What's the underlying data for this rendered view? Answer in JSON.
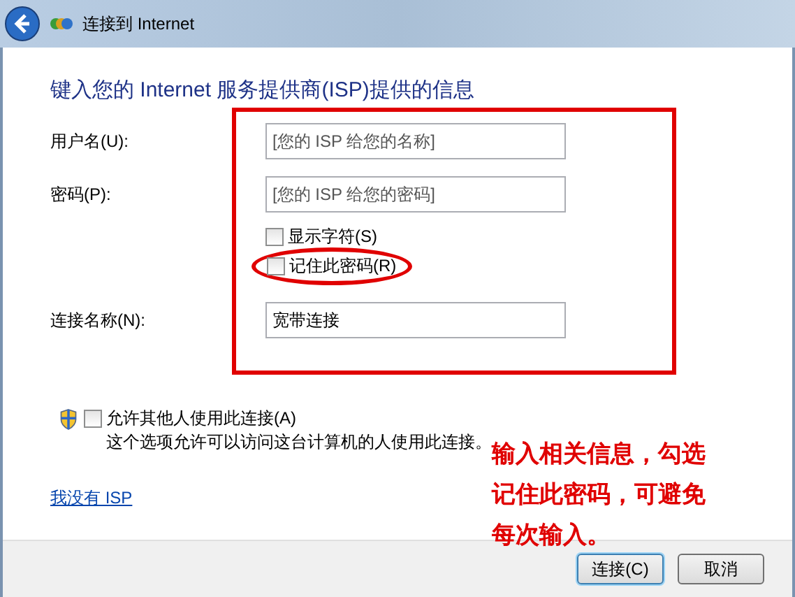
{
  "window": {
    "title": "连接到 Internet"
  },
  "heading": "键入您的 Internet 服务提供商(ISP)提供的信息",
  "fields": [
    {
      "label": "用户名(U):",
      "placeholder": "[您的 ISP 给您的名称]"
    },
    {
      "label": "密码(P):",
      "placeholder": "[您的 ISP 给您的密码]"
    },
    {
      "label": "连接名称(N):",
      "value": "宽带连接"
    }
  ],
  "password_options": [
    {
      "label": "显示字符(S)",
      "checked": false
    },
    {
      "label": "记住此密码(R)",
      "checked": false
    }
  ],
  "allow_others": {
    "label": "允许其他人使用此连接(A)",
    "checked": false,
    "description": "这个选项允许可以访问这台计算机的人使用此连接。"
  },
  "link": "我没有 ISP",
  "buttons": [
    {
      "label": "连接(C)",
      "default": true
    },
    {
      "label": "取消",
      "default": false
    }
  ],
  "annotation": "输入相关信息，勾选记住此密码，可避免每次输入。"
}
